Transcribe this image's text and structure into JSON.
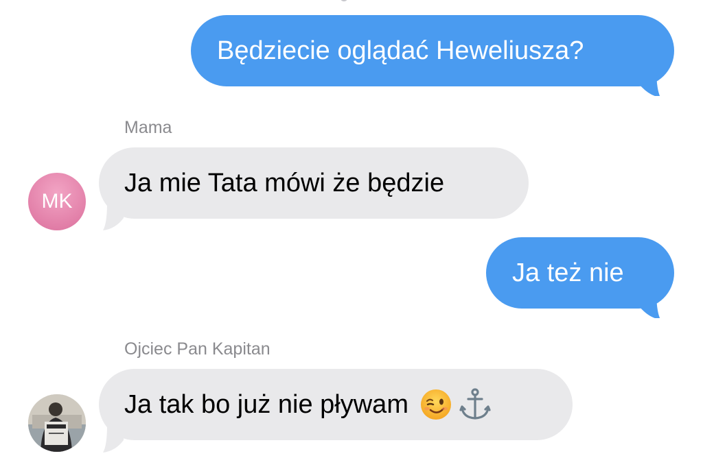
{
  "conversation": {
    "messages": [
      {
        "direction": "outgoing",
        "text": "Będziecie oglądać Heweliusza?"
      },
      {
        "direction": "incoming",
        "sender": "Mama",
        "avatar_initials": "MK",
        "text": "Ja mie Tata mówi że będzie"
      },
      {
        "direction": "outgoing",
        "text": "Ja też nie"
      },
      {
        "direction": "incoming",
        "sender": "Ojciec Pan Kapitan",
        "avatar": "photo-avatar",
        "text": "Ja tak bo już nie pływam",
        "emojis": [
          "winking-face-emoji",
          "anchor-emoji"
        ]
      }
    ]
  },
  "colors": {
    "outgoing_bubble": "#4a9bf0",
    "incoming_bubble": "#e9e9eb",
    "sender_name": "#8a8a8e",
    "avatar_mk": "#e27fa8"
  }
}
